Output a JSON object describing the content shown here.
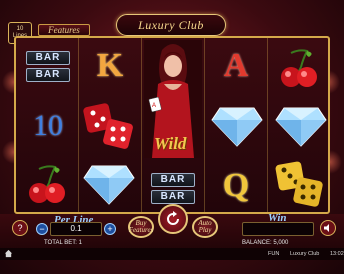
{
  "game": {
    "title": "Luxury Club",
    "lines_badge_value": "10",
    "lines_badge_label": "Lines",
    "features_tab": "Features"
  },
  "reels": {
    "wild_label": "Wild",
    "bar_label": "BAR",
    "letter_k": "K",
    "letter_a": "A",
    "letter_q": "Q",
    "ten": "10"
  },
  "controls": {
    "per_line_label": "Per Line",
    "per_line_value": "0.1",
    "buy_features_label": "Buy Features",
    "auto_play_label": "Auto Play",
    "win_label": "Win",
    "win_value": "",
    "help_label": "?",
    "minus_label": "−",
    "plus_label": "+"
  },
  "status": {
    "total_bet": "TOTAL BET: 1",
    "balance": "BALANCE: 5,000"
  },
  "footer": {
    "mode": "FUN",
    "game_name": "Luxury Club",
    "clock": "13:02"
  }
}
